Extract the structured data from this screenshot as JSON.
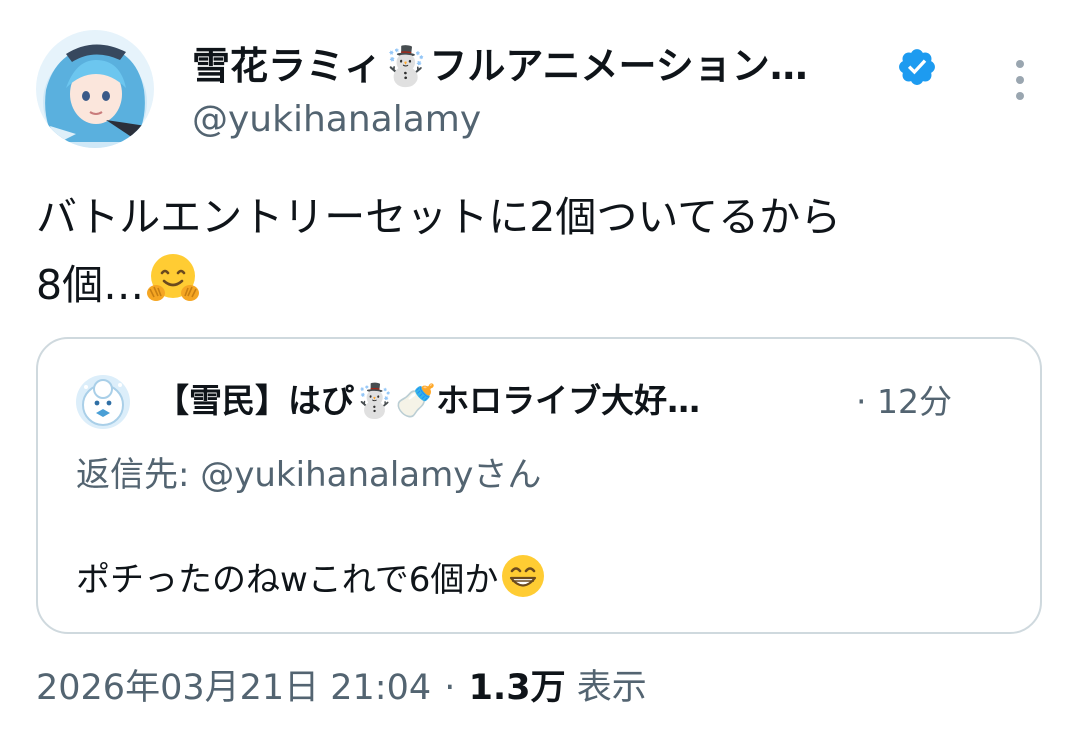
{
  "tweet": {
    "author": {
      "name": "雪花ラミィ☃️フルアニメーション…",
      "handle": "@yukihanalamy",
      "verified": true,
      "avatar_icon": "avatar-snow-girl"
    },
    "text_line1": "バトルエントリーセットに2個ついてるから",
    "text_line2": "8個…",
    "text_emoji": "hugging-face",
    "timestamp": "2026年03月21日 21:04",
    "dot": "·",
    "views_count": "1.3万",
    "views_label": "表示"
  },
  "quote": {
    "author_name": "【雪民】はぴ☃️🍼ホロライブ大好…",
    "dot": "·",
    "time": "12分",
    "reply_to": "返信先: @yukihanalamyさん",
    "text": "ポチったのねwこれで6個か",
    "text_emoji": "grinning-face"
  },
  "colors": {
    "text": "#0f1419",
    "secondary": "#536471",
    "border": "#cfd9de",
    "verified": "#1d9bf0"
  }
}
